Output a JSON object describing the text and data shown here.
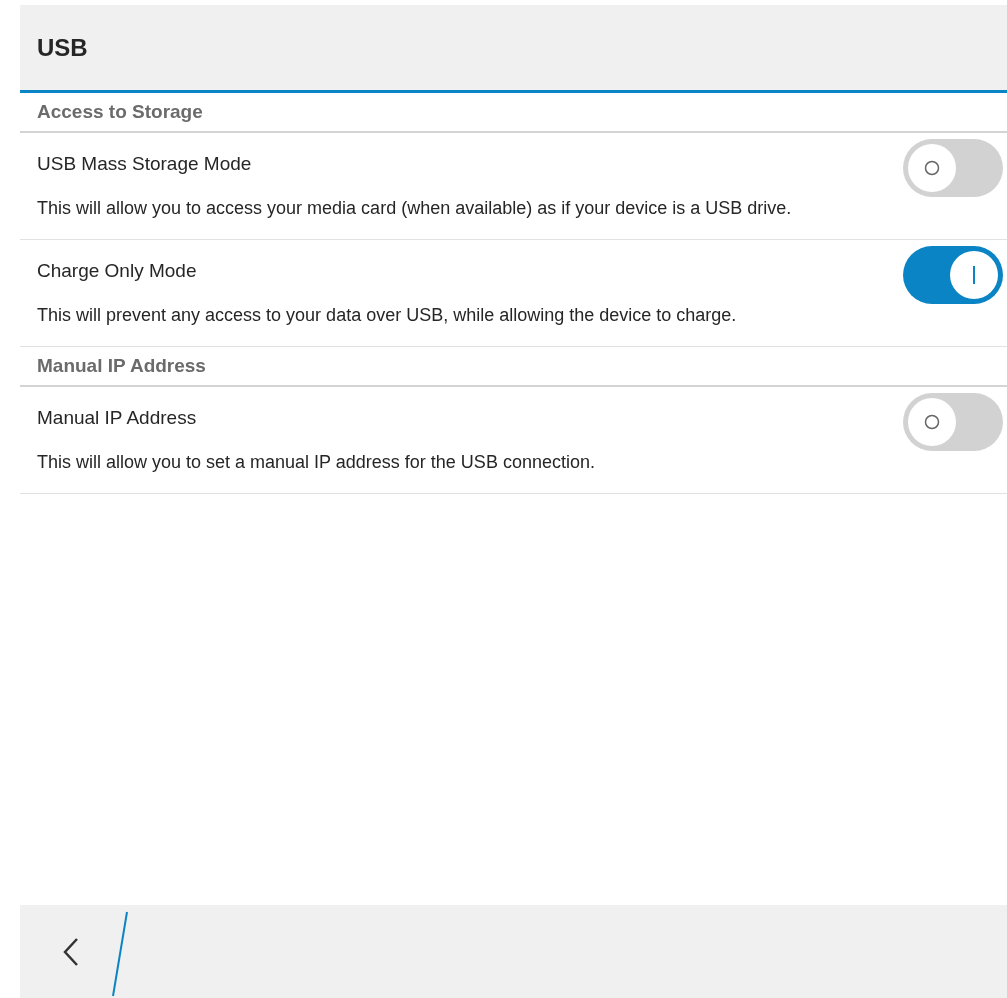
{
  "header": {
    "title": "USB"
  },
  "sections": [
    {
      "title": "Access to Storage",
      "items": [
        {
          "title": "USB Mass Storage Mode",
          "description": "This will allow you to access your media card (when available) as if your device is a USB drive.",
          "on": false
        },
        {
          "title": "Charge Only Mode",
          "description": "This will prevent any access to your data over USB, while allowing the device to charge.",
          "on": true
        }
      ]
    },
    {
      "title": "Manual IP Address",
      "items": [
        {
          "title": "Manual IP Address",
          "description": "This will allow you to set a manual IP address for the USB connection.",
          "on": false
        }
      ]
    }
  ]
}
